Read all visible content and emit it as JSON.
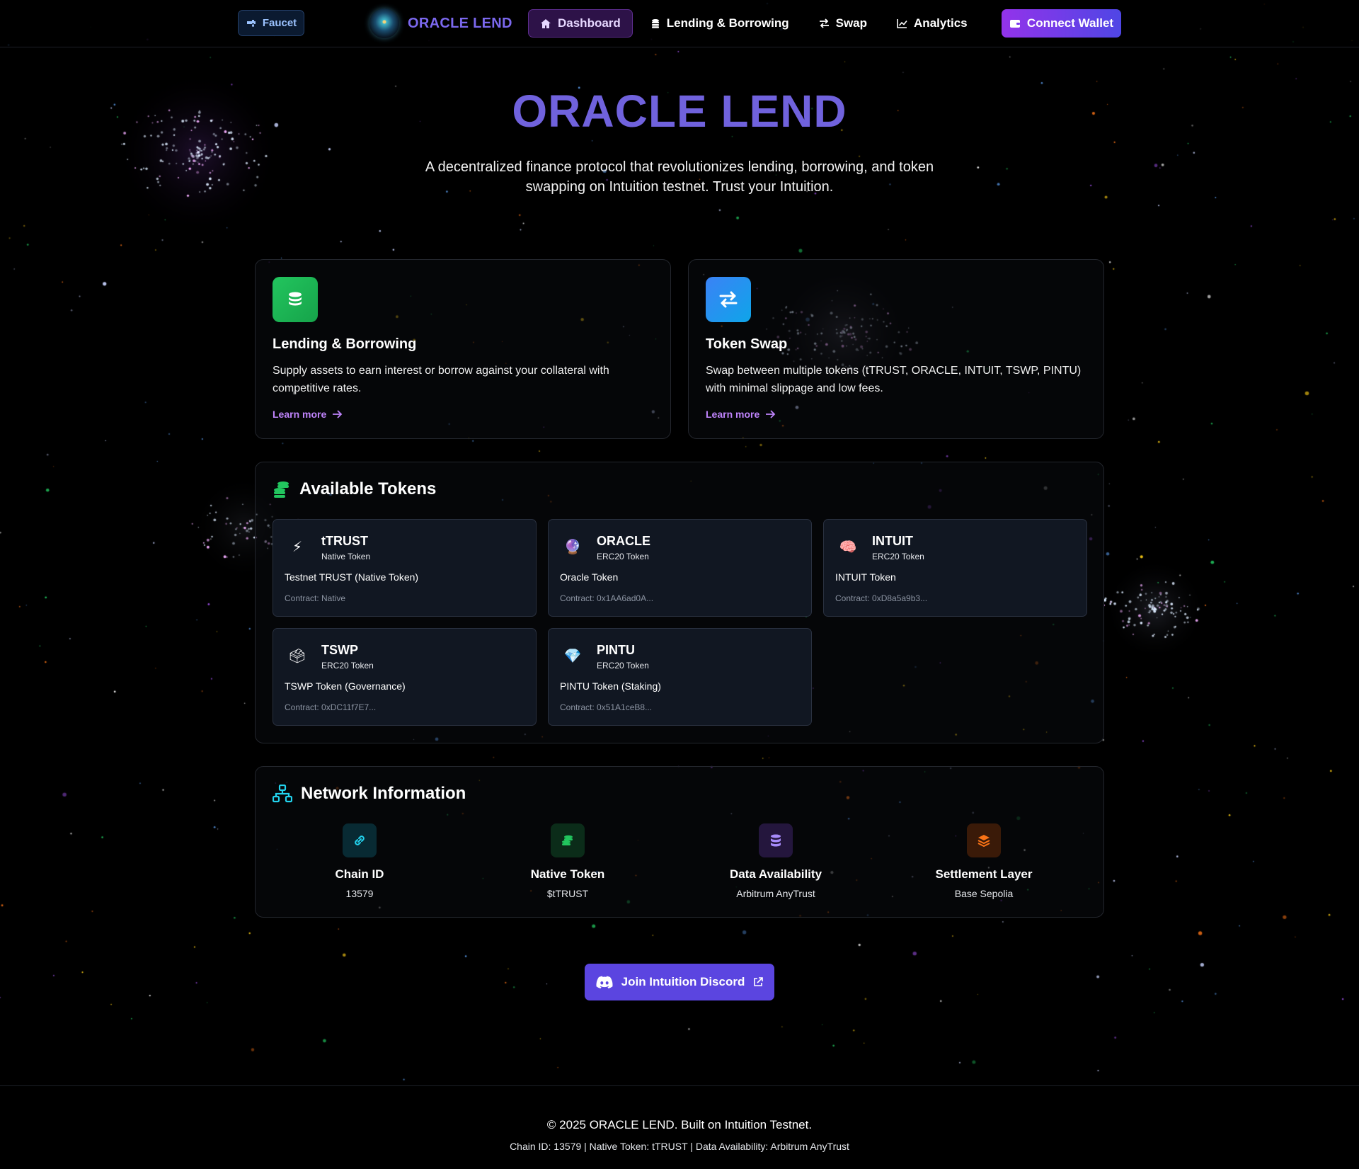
{
  "nav": {
    "faucet_label": "Faucet",
    "brand": "ORACLE LEND",
    "links": [
      "Dashboard",
      "Lending & Borrowing",
      "Swap",
      "Analytics"
    ],
    "active_link": "Dashboard",
    "wallet_label": "Connect Wallet"
  },
  "hero": {
    "title": "ORACLE LEND",
    "subtitle": "A decentralized finance protocol that revolutionizes lending, borrowing, and token swapping on Intuition testnet. Trust your Intuition."
  },
  "features": [
    {
      "icon": "coins-icon",
      "title": "Lending & Borrowing",
      "description": "Supply assets to earn interest or borrow against your collateral with competitive rates.",
      "link": "Learn more",
      "color": "#22c55e"
    },
    {
      "icon": "swap-arrows-icon",
      "title": "Token Swap",
      "description": "Swap between multiple tokens (tTRUST, ORACLE, INTUIT, TSWP, PINTU) with minimal slippage and low fees.",
      "link": "Learn more",
      "color": "#3b82f6"
    }
  ],
  "tokens_section": {
    "title": "Available Tokens",
    "tokens": [
      {
        "symbol": "tTRUST",
        "type": "Native Token",
        "name": "Testnet TRUST (Native Token)",
        "contract": "Contract: Native",
        "icon": "⚡"
      },
      {
        "symbol": "ORACLE",
        "type": "ERC20 Token",
        "name": "Oracle Token",
        "contract": "Contract: 0x1AA6ad0A...",
        "icon": "🔮"
      },
      {
        "symbol": "INTUIT",
        "type": "ERC20 Token",
        "name": "INTUIT Token",
        "contract": "Contract: 0xD8a5a9b3...",
        "icon": "🧠"
      },
      {
        "symbol": "TSWP",
        "type": "ERC20 Token",
        "name": "TSWP Token (Governance)",
        "contract": "Contract: 0xDC11f7E7...",
        "icon": "🗳"
      },
      {
        "symbol": "PINTU",
        "type": "ERC20 Token",
        "name": "PINTU Token (Staking)",
        "contract": "Contract: 0x51A1ceB8...",
        "icon": "💎"
      }
    ]
  },
  "network": {
    "title": "Network Information",
    "items": [
      {
        "label": "Chain ID",
        "value": "13579",
        "icon": "link-icon",
        "color": "#22d3ee"
      },
      {
        "label": "Native Token",
        "value": "$tTRUST",
        "icon": "coins-icon",
        "color": "#22c55e"
      },
      {
        "label": "Data Availability",
        "value": "Arbitrum AnyTrust",
        "icon": "database-icon",
        "color": "#a78bfa"
      },
      {
        "label": "Settlement Layer",
        "value": "Base Sepolia",
        "icon": "layers-icon",
        "color": "#f97316"
      }
    ]
  },
  "discord_label": "Join Intuition Discord",
  "footer": {
    "line1": "© 2025 ORACLE LEND. Built on Intuition Testnet.",
    "line2": "Chain ID: 13579 | Native Token: tTRUST | Data Availability: Arbitrum AnyTrust"
  }
}
